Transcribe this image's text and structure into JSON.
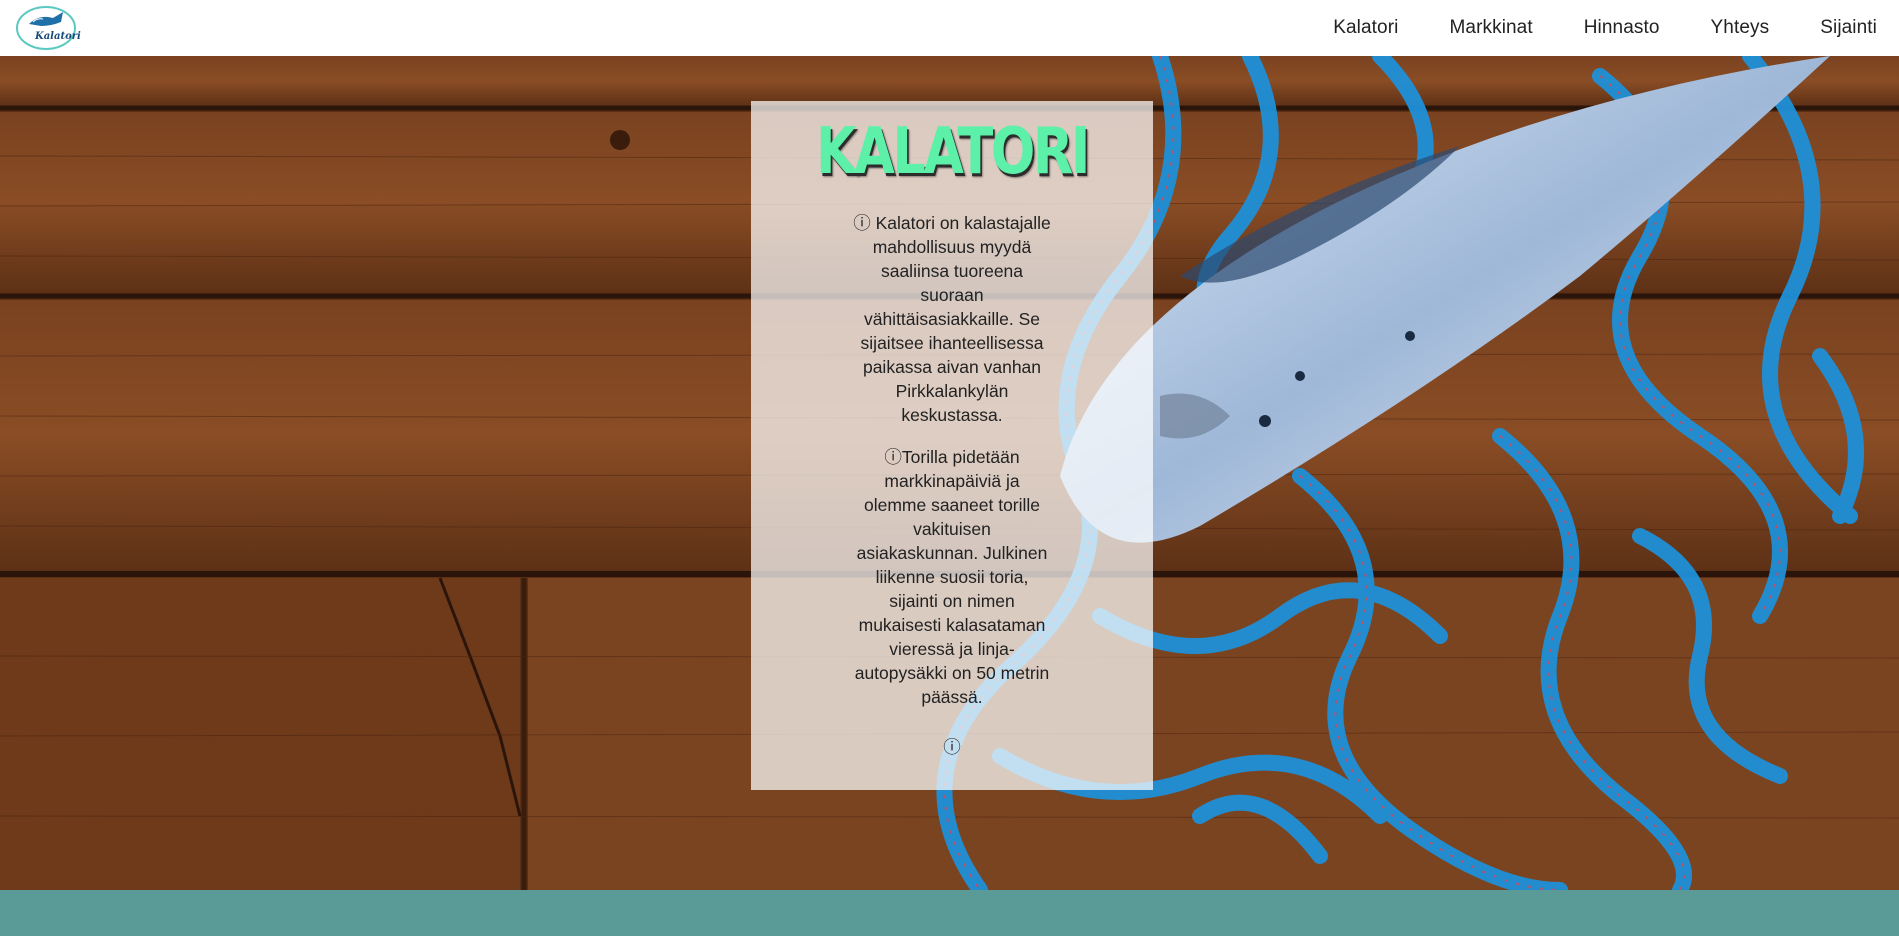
{
  "header": {
    "logo_text": "Kalatori",
    "nav": [
      "Kalatori",
      "Markkinat",
      "Hinnasto",
      "Yhteys",
      "Sijainti"
    ]
  },
  "hero": {
    "title": "KALATORI",
    "paragraph1": "ⓘ Kalatori on kalastajalle mahdollisuus myydä saaliinsa tuoreena suoraan vähittäisasiakkaille. Se sijaitsee ihanteellisessa paikassa aivan vanhan Pirkkalankylän keskustassa.",
    "paragraph2": "ⓘTorilla pidetään markkinapäiviä ja olemme saaneet torille vakituisen asiakaskunnan. Julkinen liikenne suosii toria, sijainti on nimen mukaisesti kalasataman vieressä ja linja-autopysäkki on 50 metrin päässä.",
    "paragraph3": "ⓘ"
  },
  "colors": {
    "title_green": "#5cf0a8",
    "footer_teal": "#5a9b98",
    "wood": "#6b3a1a",
    "rope_blue": "#1e90d8"
  }
}
